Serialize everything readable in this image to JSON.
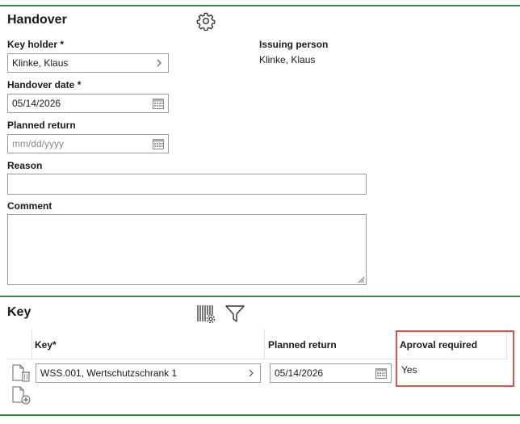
{
  "handover": {
    "title": "Handover",
    "key_holder_label": "Key holder *",
    "key_holder_value": "Klinke, Klaus",
    "issuing_person_label": "Issuing person",
    "issuing_person_value": "Klinke, Klaus",
    "handover_date_label": "Handover date *",
    "handover_date_value": "05/14/2026",
    "planned_return_label": "Planned return",
    "planned_return_placeholder": "mm/dd/yyyy",
    "reason_label": "Reason",
    "reason_value": "",
    "comment_label": "Comment",
    "comment_value": ""
  },
  "key_section": {
    "title": "Key",
    "columns": {
      "key": "Key*",
      "planned_return": "Planned return",
      "approval": "Aproval required"
    },
    "rows": [
      {
        "key": "WSS.001, Wertschutzschrank 1",
        "planned_return": "05/14/2026",
        "approval": "Yes"
      }
    ]
  },
  "colors": {
    "accent_rule": "#2e8b4a",
    "highlight_box": "#d9534f"
  },
  "icons": [
    "settings-gear-icon",
    "barcode-settings-icon",
    "filter-funnel-icon",
    "delete-document-icon",
    "add-document-icon",
    "chevron-right-icon",
    "calendar-icon"
  ]
}
